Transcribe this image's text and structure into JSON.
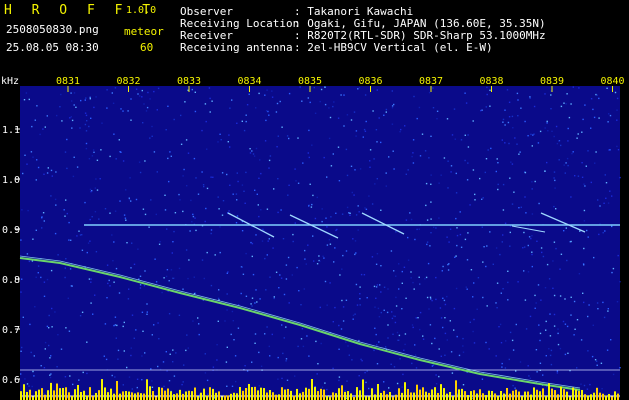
{
  "app": {
    "name": "H R O F F T",
    "version": "1.0.0"
  },
  "file": {
    "name": "2508050830.png",
    "datetime": "25.08.05 08:30"
  },
  "count": {
    "label": "meteor",
    "value": "60"
  },
  "info": [
    {
      "label": "Observer",
      "value": ": Takanori Kawachi"
    },
    {
      "label": "Receiving Location",
      "value": ": Ogaki, Gifu, JAPAN (136.60E, 35.35N)"
    },
    {
      "label": "Receiver",
      "value": ": R820T2(RTL-SDR) SDR-Sharp 53.1000MHz"
    },
    {
      "label": "Receiving antenna",
      "value": ": 2el-HB9CV Vertical (el. E-W)"
    }
  ],
  "axis": {
    "unit": "kHz",
    "x_ticks": [
      "0831",
      "0832",
      "0833",
      "0834",
      "0835",
      "0836",
      "0837",
      "0838",
      "0839",
      "0840"
    ],
    "y_ticks": [
      "1.1",
      "1.0",
      "0.9",
      "0.8",
      "0.7",
      "0.6"
    ]
  },
  "colors": {
    "background": "#000000",
    "spectrum": "#0a0a8a",
    "label_yellow": "#f4f400",
    "trace": "#7fd0ff"
  }
}
